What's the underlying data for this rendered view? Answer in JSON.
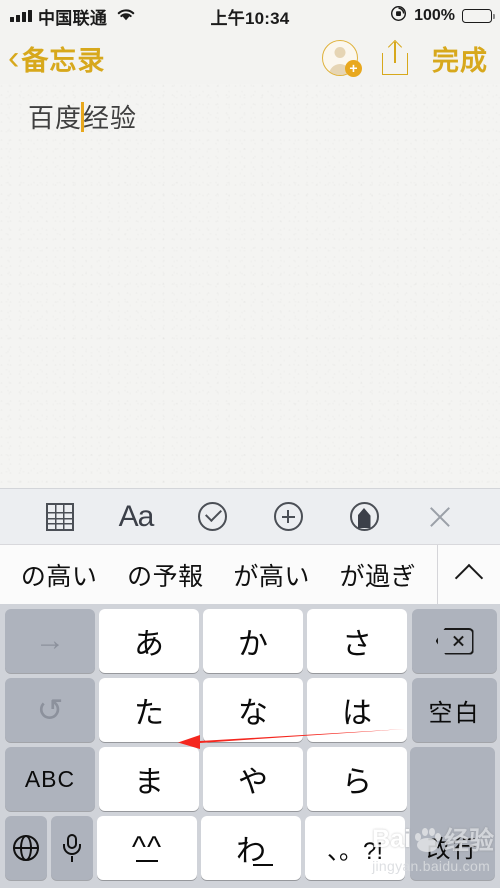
{
  "status_bar": {
    "carrier": "中国联通",
    "time": "上午10:34",
    "battery_percent": "100%",
    "signal_icon": "signal-bars-icon",
    "wifi_icon": "wifi-icon",
    "rotation_lock_icon": "rotation-lock-icon"
  },
  "nav_bar": {
    "back_label": "备忘录",
    "back_chevron": "‹",
    "add_person_icon": "add-person-icon",
    "share_icon": "share-icon",
    "done_label": "完成",
    "accent_color": "#d7a81c"
  },
  "note": {
    "text_before_caret": "百度",
    "text_after_caret": "经验",
    "caret_color": "#e8a81e"
  },
  "format_toolbar": {
    "items": [
      {
        "name": "table-icon",
        "label": ""
      },
      {
        "name": "text-format-icon",
        "label": "Aa"
      },
      {
        "name": "checklist-icon",
        "label": ""
      },
      {
        "name": "add-attachment-icon",
        "label": ""
      },
      {
        "name": "markup-pen-icon",
        "label": ""
      },
      {
        "name": "close-icon",
        "label": ""
      }
    ]
  },
  "prediction_bar": {
    "candidates": [
      "の高い",
      "の予報",
      "が高い",
      "が過ぎ"
    ],
    "expand_icon": "chevron-up-icon"
  },
  "keyboard": {
    "type": "japanese-kana-10key",
    "rows": [
      {
        "left": {
          "label": "→",
          "name": "key-next-candidate",
          "style": "gray dim"
        },
        "letters": [
          "あ",
          "か",
          "さ"
        ],
        "right": {
          "label": "",
          "name": "key-delete",
          "style": "gray"
        }
      },
      {
        "left": {
          "label": "↺",
          "name": "key-undo",
          "style": "gray dim"
        },
        "letters": [
          "た",
          "な",
          "は"
        ],
        "right": {
          "label": "空白",
          "name": "key-space",
          "style": "gray"
        }
      },
      {
        "left": {
          "label": "ABC",
          "name": "key-abc",
          "style": "gray"
        },
        "letters": [
          "ま",
          "や",
          "ら"
        ],
        "right": {
          "label": "改行",
          "name": "key-return",
          "style": "gray"
        }
      },
      {
        "left_small": [
          {
            "label": "",
            "name": "key-globe"
          },
          {
            "label": "",
            "name": "key-dictation"
          }
        ],
        "letters": [
          "^^",
          "わ",
          "、。?!"
        ]
      }
    ],
    "return_label": "改行",
    "space_label": "空白",
    "abc_label": "ABC",
    "key_white_color": "#ffffff",
    "key_gray_color": "#aeb3bd",
    "keyboard_bg_color": "#d0d3d9"
  },
  "annotation": {
    "arrow_color": "#f4271f",
    "arrow_name": "red-pointer-arrow"
  },
  "watermark": {
    "brand_bai": "Bai",
    "brand_du": "du",
    "brand_jy": "经验",
    "site": "jingyan.baidu.com"
  }
}
